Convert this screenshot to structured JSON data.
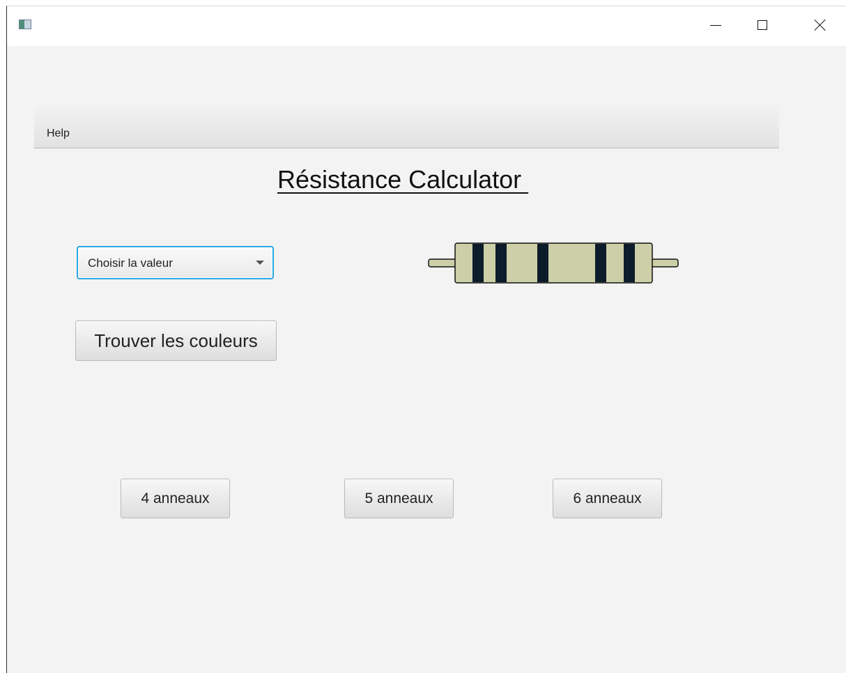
{
  "window": {
    "title": ""
  },
  "menu": {
    "help_label": "Help"
  },
  "main": {
    "title": "Résistance Calculator ",
    "value_select": {
      "selected": "Choisir la valeur"
    },
    "find_colors_label": "Trouver les couleurs",
    "ring_buttons": [
      {
        "label": "4 anneaux"
      },
      {
        "label": "5 anneaux"
      },
      {
        "label": "6 anneaux"
      }
    ]
  },
  "resistor": {
    "body_color": "#cccfa7",
    "lead_color": "#cccfa7",
    "band_colors": [
      "#0d1c2a",
      "#0d1c2a",
      "#0d1c2a",
      "#0d1c2a",
      "#0d1c2a"
    ]
  }
}
